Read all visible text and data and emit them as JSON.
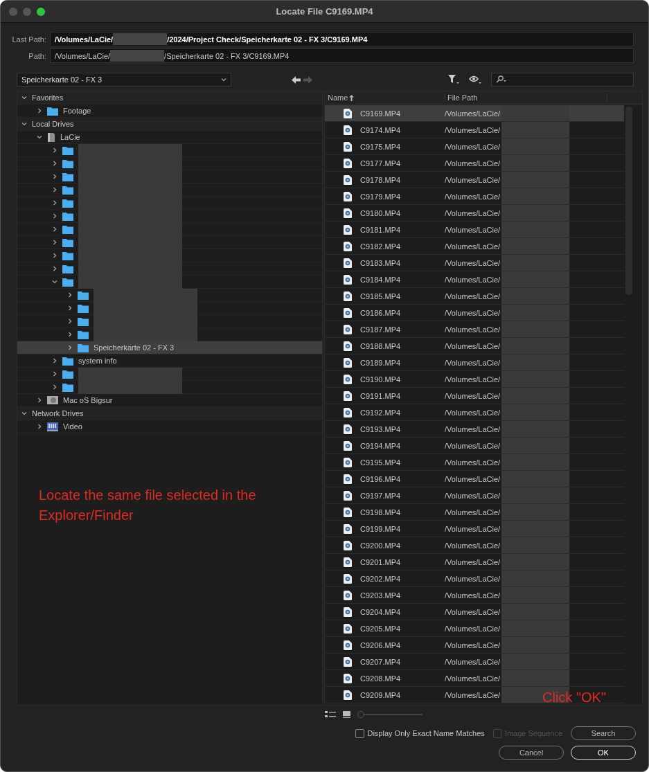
{
  "window": {
    "title": "Locate File C9169.MP4"
  },
  "last_path": {
    "label": "Last Path:",
    "prefix": "/Volumes/LaCie/",
    "suffix": "/2024/Project Check/Speicherkarte 02 - FX 3/C9169.MP4"
  },
  "path": {
    "label": "Path:",
    "prefix": "/Volumes/LaCie/",
    "suffix": "/Speicherkarte 02 - FX 3/C9169.MP4"
  },
  "location_dropdown": {
    "value": "Speicherkarte 02 - FX 3"
  },
  "tree": [
    {
      "kind": "section",
      "label": "Favorites",
      "expanded": true,
      "selected": false,
      "children": [
        {
          "kind": "folder",
          "label": "Footage",
          "expanded": false,
          "selected": false
        }
      ]
    },
    {
      "kind": "section",
      "label": "Local Drives",
      "expanded": true,
      "selected": false,
      "children": [
        {
          "kind": "drive",
          "label": "LaCie",
          "expanded": true,
          "selected": false,
          "children": [
            {
              "kind": "folder",
              "redacted": true,
              "expanded": false,
              "selected": false
            },
            {
              "kind": "folder",
              "redacted": true,
              "expanded": false,
              "selected": false
            },
            {
              "kind": "folder",
              "redacted": true,
              "expanded": false,
              "selected": false
            },
            {
              "kind": "folder",
              "redacted": true,
              "expanded": false,
              "selected": false
            },
            {
              "kind": "folder",
              "redacted": true,
              "expanded": false,
              "selected": false
            },
            {
              "kind": "folder",
              "redacted": true,
              "expanded": false,
              "selected": false
            },
            {
              "kind": "folder",
              "redacted": true,
              "expanded": false,
              "selected": false
            },
            {
              "kind": "folder",
              "redacted": true,
              "expanded": false,
              "selected": false
            },
            {
              "kind": "folder",
              "redacted": true,
              "expanded": false,
              "selected": false
            },
            {
              "kind": "folder",
              "redacted": true,
              "expanded": false,
              "selected": false
            },
            {
              "kind": "folder",
              "redacted": true,
              "expanded": true,
              "selected": false,
              "children": [
                {
                  "kind": "folder",
                  "redacted": true,
                  "expanded": false,
                  "selected": false
                },
                {
                  "kind": "folder",
                  "redacted": true,
                  "expanded": false,
                  "selected": false
                },
                {
                  "kind": "folder",
                  "redacted": true,
                  "expanded": false,
                  "selected": false
                },
                {
                  "kind": "folder",
                  "redacted": true,
                  "expanded": false,
                  "selected": false
                },
                {
                  "kind": "folder",
                  "label": "Speicherkarte 02 - FX 3",
                  "expanded": false,
                  "selected": true
                }
              ]
            },
            {
              "kind": "folder",
              "label": "system info",
              "expanded": false,
              "selected": false
            },
            {
              "kind": "folder",
              "redacted": true,
              "expanded": false,
              "selected": false
            },
            {
              "kind": "folder",
              "redacted": true,
              "expanded": false,
              "selected": false
            }
          ]
        },
        {
          "kind": "disk",
          "label": "Mac oS Bigsur",
          "expanded": false,
          "selected": false
        }
      ]
    },
    {
      "kind": "section",
      "label": "Network Drives",
      "expanded": true,
      "selected": false,
      "children": [
        {
          "kind": "network",
          "label": "Video",
          "expanded": false,
          "selected": false
        }
      ]
    }
  ],
  "annotation": "Locate the same file selected in the Explorer/Finder",
  "columns": [
    {
      "label": "Name",
      "sorted": true
    },
    {
      "label": "File Path",
      "sorted": false
    }
  ],
  "files": [
    {
      "name": "C9169.MP4",
      "path": "/Volumes/LaCie/",
      "selected": true
    },
    {
      "name": "C9174.MP4",
      "path": "/Volumes/LaCie/",
      "selected": false
    },
    {
      "name": "C9175.MP4",
      "path": "/Volumes/LaCie/",
      "selected": false
    },
    {
      "name": "C9177.MP4",
      "path": "/Volumes/LaCie/",
      "selected": false
    },
    {
      "name": "C9178.MP4",
      "path": "/Volumes/LaCie/",
      "selected": false
    },
    {
      "name": "C9179.MP4",
      "path": "/Volumes/LaCie/",
      "selected": false
    },
    {
      "name": "C9180.MP4",
      "path": "/Volumes/LaCie/",
      "selected": false
    },
    {
      "name": "C9181.MP4",
      "path": "/Volumes/LaCie/",
      "selected": false
    },
    {
      "name": "C9182.MP4",
      "path": "/Volumes/LaCie/",
      "selected": false
    },
    {
      "name": "C9183.MP4",
      "path": "/Volumes/LaCie/",
      "selected": false
    },
    {
      "name": "C9184.MP4",
      "path": "/Volumes/LaCie/",
      "selected": false
    },
    {
      "name": "C9185.MP4",
      "path": "/Volumes/LaCie/",
      "selected": false
    },
    {
      "name": "C9186.MP4",
      "path": "/Volumes/LaCie/",
      "selected": false
    },
    {
      "name": "C9187.MP4",
      "path": "/Volumes/LaCie/",
      "selected": false
    },
    {
      "name": "C9188.MP4",
      "path": "/Volumes/LaCie/",
      "selected": false
    },
    {
      "name": "C9189.MP4",
      "path": "/Volumes/LaCie/",
      "selected": false
    },
    {
      "name": "C9190.MP4",
      "path": "/Volumes/LaCie/",
      "selected": false
    },
    {
      "name": "C9191.MP4",
      "path": "/Volumes/LaCie/",
      "selected": false
    },
    {
      "name": "C9192.MP4",
      "path": "/Volumes/LaCie/",
      "selected": false
    },
    {
      "name": "C9193.MP4",
      "path": "/Volumes/LaCie/",
      "selected": false
    },
    {
      "name": "C9194.MP4",
      "path": "/Volumes/LaCie/",
      "selected": false
    },
    {
      "name": "C9195.MP4",
      "path": "/Volumes/LaCie/",
      "selected": false
    },
    {
      "name": "C9196.MP4",
      "path": "/Volumes/LaCie/",
      "selected": false
    },
    {
      "name": "C9197.MP4",
      "path": "/Volumes/LaCie/",
      "selected": false
    },
    {
      "name": "C9198.MP4",
      "path": "/Volumes/LaCie/",
      "selected": false
    },
    {
      "name": "C9199.MP4",
      "path": "/Volumes/LaCie/",
      "selected": false
    },
    {
      "name": "C9200.MP4",
      "path": "/Volumes/LaCie/",
      "selected": false
    },
    {
      "name": "C9201.MP4",
      "path": "/Volumes/LaCie/",
      "selected": false
    },
    {
      "name": "C9202.MP4",
      "path": "/Volumes/LaCie/",
      "selected": false
    },
    {
      "name": "C9203.MP4",
      "path": "/Volumes/LaCie/",
      "selected": false
    },
    {
      "name": "C9204.MP4",
      "path": "/Volumes/LaCie/",
      "selected": false
    },
    {
      "name": "C9205.MP4",
      "path": "/Volumes/LaCie/",
      "selected": false
    },
    {
      "name": "C9206.MP4",
      "path": "/Volumes/LaCie/",
      "selected": false
    },
    {
      "name": "C9207.MP4",
      "path": "/Volumes/LaCie/",
      "selected": false
    },
    {
      "name": "C9208.MP4",
      "path": "/Volumes/LaCie/",
      "selected": false
    },
    {
      "name": "C9209.MP4",
      "path": "/Volumes/LaCie/",
      "selected": false
    }
  ],
  "zoom_slider": {
    "level": 0
  },
  "options": [
    {
      "label": "Display Only Exact Name Matches",
      "checked": false,
      "disabled": false
    },
    {
      "label": "Image Sequence",
      "checked": false,
      "disabled": true
    }
  ],
  "buttons": [
    {
      "label": "Search",
      "kind": "secondary"
    },
    {
      "label": "Cancel",
      "kind": "secondary"
    },
    {
      "label": "OK",
      "kind": "primary"
    }
  ],
  "callout": "Click \"OK\""
}
